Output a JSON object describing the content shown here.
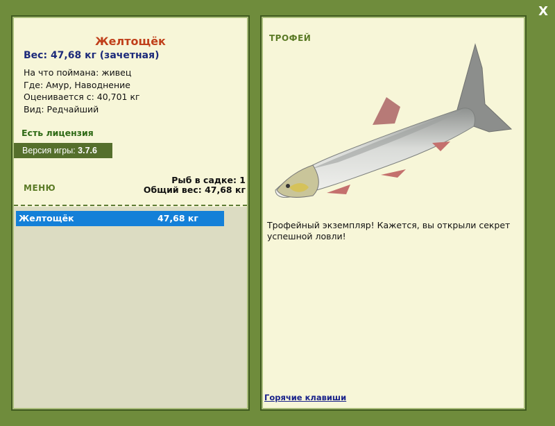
{
  "window": {
    "close_label": "X"
  },
  "catch": {
    "fish_name": "Желтощёк",
    "weight_line": "Вес: 47,68 кг (зачетная)",
    "info": [
      "На что поймана: живец",
      "Где: Амур, Наводнение",
      "Оценивается с: 40,701 кг",
      "Вид: Редчайший"
    ],
    "license": "Есть лицензия",
    "version_label": "Версия игры:",
    "version_value": "3.7.6"
  },
  "menu": {
    "label": "МЕНЮ"
  },
  "stats": {
    "fish_count": "Рыб в садке: 1",
    "total_weight": "Общий вес: 47,68 кг"
  },
  "keepnet": {
    "items": [
      {
        "name": "Желтощёк",
        "weight": "47,68 кг"
      }
    ]
  },
  "trophy": {
    "label": "ТРОФЕЙ",
    "description": "Трофейный экземпляр! Кажется, вы открыли секрет успешной ловли!",
    "hotkeys_link": "Горячие клавиши"
  },
  "colors": {
    "background": "#6f8c3c",
    "panel": "#f7f6d8",
    "fish_name": "#c0401b",
    "weight": "#1c2a7a",
    "selected_item": "#1480d8"
  }
}
